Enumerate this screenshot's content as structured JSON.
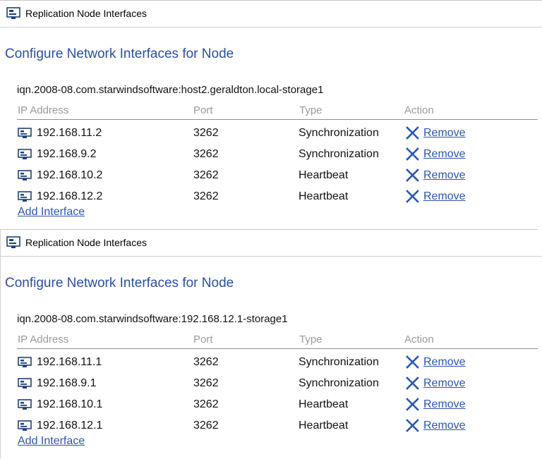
{
  "panels": [
    {
      "header_title": "Replication Node Interfaces",
      "heading": "Configure Network Interfaces for Node",
      "target_name": "iqn.2008-08.com.starwindsoftware:host2.geraldton.local-storage1",
      "columns": {
        "ip": "IP Address",
        "port": "Port",
        "type": "Type",
        "action": "Action"
      },
      "rows": [
        {
          "ip": "192.168.11.2",
          "port": "3262",
          "type": "Synchronization",
          "action": "Remove"
        },
        {
          "ip": "192.168.9.2",
          "port": "3262",
          "type": "Synchronization",
          "action": "Remove"
        },
        {
          "ip": "192.168.10.2",
          "port": "3262",
          "type": "Heartbeat",
          "action": "Remove"
        },
        {
          "ip": "192.168.12.2",
          "port": "3262",
          "type": "Heartbeat",
          "action": "Remove"
        }
      ],
      "add_interface": "Add Interface"
    },
    {
      "header_title": "Replication Node Interfaces",
      "heading": "Configure Network Interfaces for Node",
      "target_name": "iqn.2008-08.com.starwindsoftware:192.168.12.1-storage1",
      "columns": {
        "ip": "IP Address",
        "port": "Port",
        "type": "Type",
        "action": "Action"
      },
      "rows": [
        {
          "ip": "192.168.11.1",
          "port": "3262",
          "type": "Synchronization",
          "action": "Remove"
        },
        {
          "ip": "192.168.9.1",
          "port": "3262",
          "type": "Synchronization",
          "action": "Remove"
        },
        {
          "ip": "192.168.10.1",
          "port": "3262",
          "type": "Heartbeat",
          "action": "Remove"
        },
        {
          "ip": "192.168.12.1",
          "port": "3262",
          "type": "Heartbeat",
          "action": "Remove"
        }
      ],
      "add_interface": "Add Interface"
    }
  ],
  "icons": {
    "window": "network-window-icon",
    "row": "network-adapter-icon",
    "remove": "close-x-icon"
  },
  "colors": {
    "heading": "#2b4f9e",
    "link": "#2a56b0",
    "remove_x": "#2a56b0",
    "column_header": "#9a9a9a"
  }
}
